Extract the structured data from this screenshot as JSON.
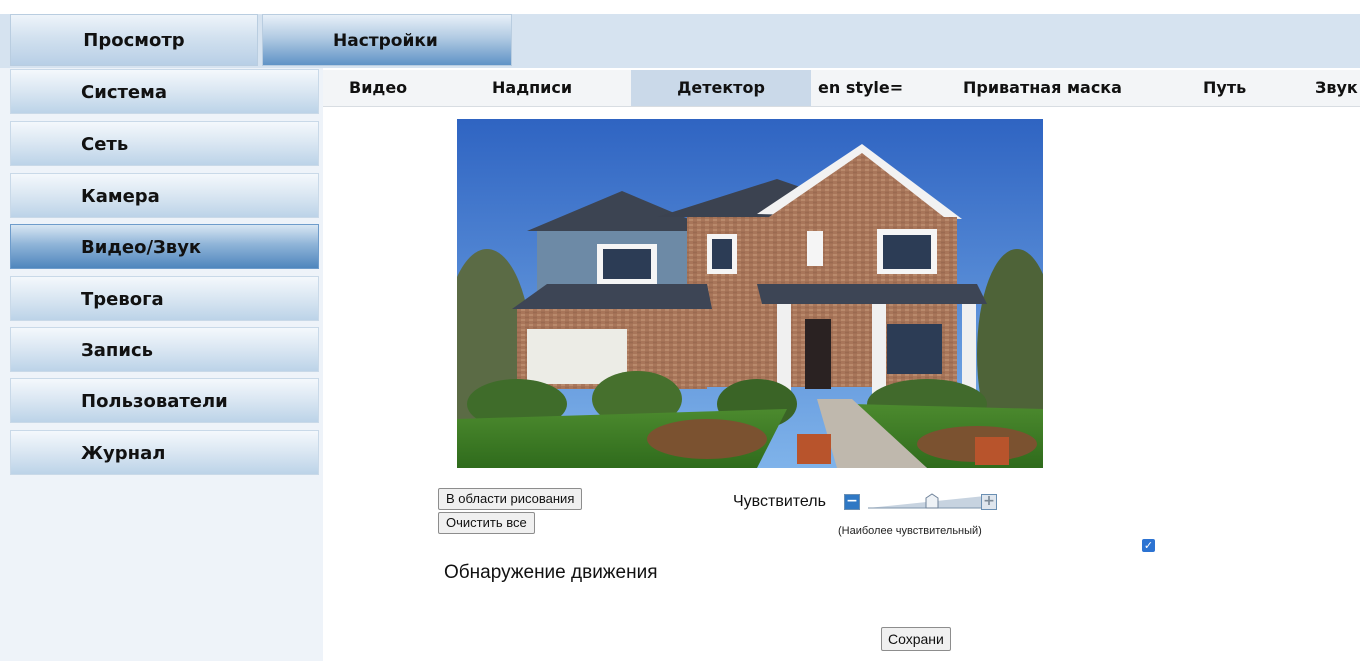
{
  "top_tabs": {
    "view": "Просмотр",
    "settings": "Настройки"
  },
  "sidebar": {
    "items": [
      {
        "label": "Система"
      },
      {
        "label": "Сеть"
      },
      {
        "label": "Камера"
      },
      {
        "label": "Видео/Звук"
      },
      {
        "label": "Тревога"
      },
      {
        "label": "Запись"
      },
      {
        "label": "Пользователи"
      },
      {
        "label": "Журнал"
      }
    ],
    "active": "Видео/Звук"
  },
  "sub_tabs": {
    "items": [
      {
        "label": "Видео"
      },
      {
        "label": "Надписи"
      },
      {
        "label": "Детектор"
      },
      {
        "label": "en style="
      },
      {
        "label": "Приватная маска"
      },
      {
        "label": "Путь"
      },
      {
        "label": "Звук"
      }
    ],
    "active": "Детектор"
  },
  "detector": {
    "draw_area_label": "В области рисования",
    "clear_all_label": "Очистить все",
    "sensitivity_label": "Чувствитель",
    "minus_label": "−",
    "plus_label": "+",
    "sensitivity_hint": "(Наиболее чувствительный)",
    "sensitivity_level": 0.55,
    "motion_detection_label": "Обнаружение движения",
    "motion_detection_enabled": true,
    "save_label": "Сохрани"
  },
  "colors": {
    "accent": "#4f86bd",
    "checkbox": "#2c73d2",
    "minus_button": "#2f78c4"
  }
}
